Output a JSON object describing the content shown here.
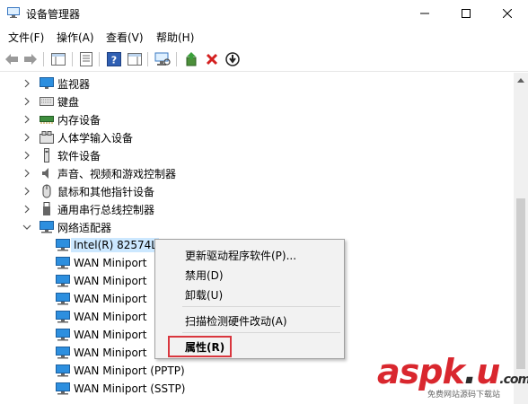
{
  "window": {
    "title": "设备管理器"
  },
  "menu": [
    "文件(F)",
    "操作(A)",
    "查看(V)",
    "帮助(H)"
  ],
  "toolbar": {
    "icons": [
      "back-icon",
      "forward-icon",
      "show-hide-tree-icon",
      "properties-icon",
      "help-icon",
      "action-pane-icon",
      "scan-hardware-icon",
      "update-driver-icon",
      "uninstall-icon",
      "disable-icon"
    ]
  },
  "tree": {
    "categories": [
      {
        "label": "监视器",
        "icon": "monitor-icon"
      },
      {
        "label": "键盘",
        "icon": "keyboard-icon"
      },
      {
        "label": "内存设备",
        "icon": "memory-icon"
      },
      {
        "label": "人体学输入设备",
        "icon": "hid-icon"
      },
      {
        "label": "软件设备",
        "icon": "software-device-icon"
      },
      {
        "label": "声音、视频和游戏控制器",
        "icon": "speaker-icon"
      },
      {
        "label": "鼠标和其他指针设备",
        "icon": "mouse-icon"
      },
      {
        "label": "通用串行总线控制器",
        "icon": "usb-icon"
      }
    ],
    "expanded": {
      "label": "网络适配器",
      "icon": "network-adapter-icon"
    },
    "children": [
      {
        "label": "Intel(R) 82574L",
        "selected": true
      },
      {
        "label": "WAN Miniport"
      },
      {
        "label": "WAN Miniport"
      },
      {
        "label": "WAN Miniport"
      },
      {
        "label": "WAN Miniport"
      },
      {
        "label": "WAN Miniport"
      },
      {
        "label": "WAN Miniport"
      },
      {
        "label": "WAN Miniport (PPTP)"
      },
      {
        "label": "WAN Miniport (SSTP)"
      }
    ]
  },
  "context_menu": {
    "update_driver": "更新驱动程序软件(P)...",
    "disable": "禁用(D)",
    "uninstall": "卸载(U)",
    "scan": "扫描检测硬件改动(A)",
    "properties": "属性(R)"
  },
  "watermark": {
    "logo_main": "asp",
    "logo_k": "k",
    "logo_dot": ".",
    "logo_u": "u",
    "logo_com": ".com",
    "sub": "免费网站源码下载站"
  },
  "colors": {
    "selection": "#cce8ff",
    "highlight_border": "#d9363e",
    "watermark_red": "#d9272e"
  }
}
